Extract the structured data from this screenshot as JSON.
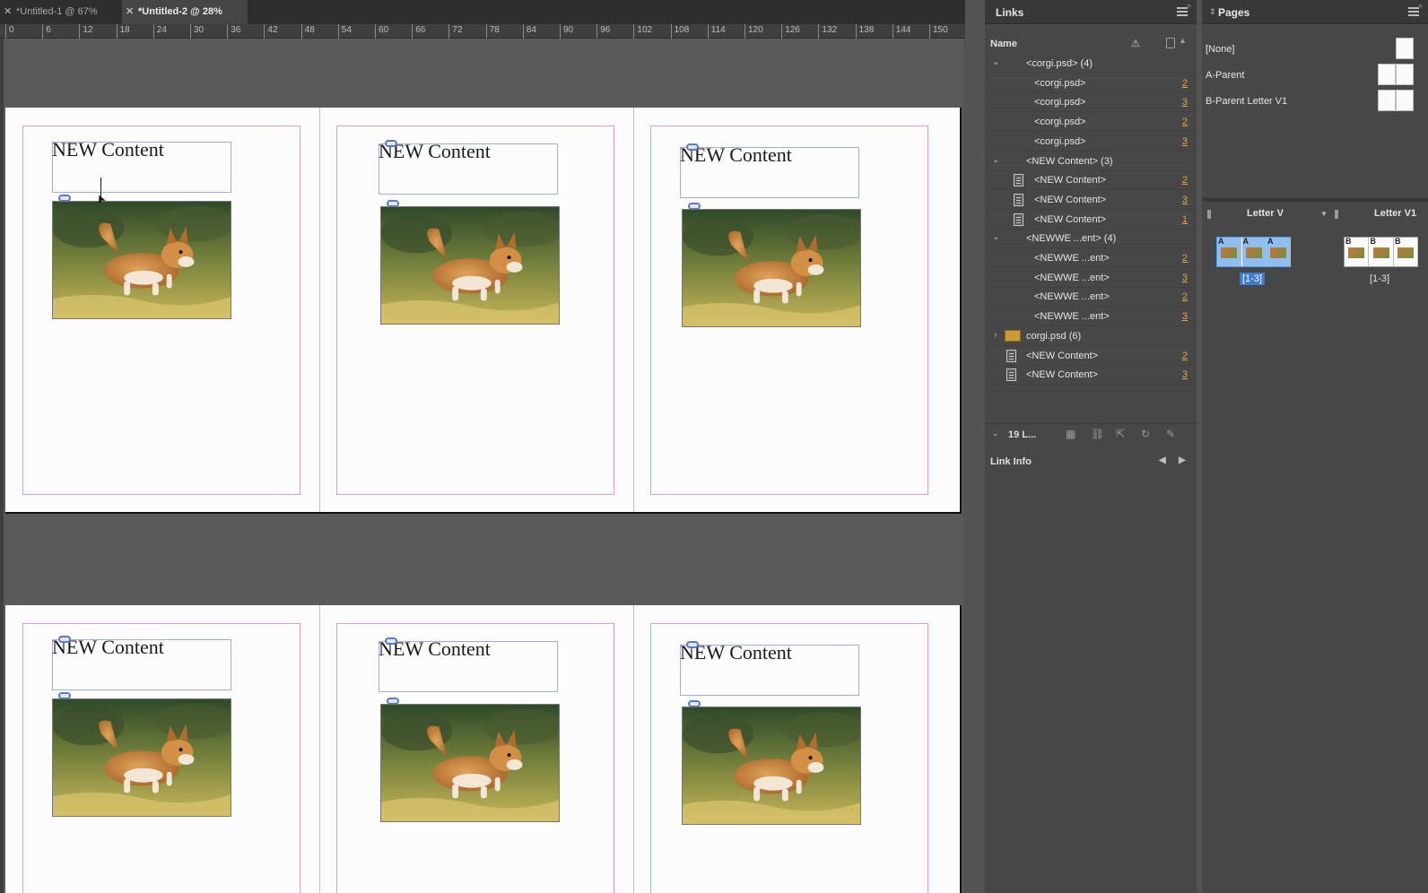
{
  "tabs": [
    {
      "label": "*Untitled-1 @ 67%",
      "active": false
    },
    {
      "label": "*Untitled-2 @ 28%",
      "active": true
    }
  ],
  "ruler": {
    "ticks": [
      "0",
      "6",
      "12",
      "18",
      "24",
      "30",
      "36",
      "42",
      "48",
      "54",
      "60",
      "66",
      "72",
      "78",
      "84",
      "90",
      "96",
      "102",
      "108",
      "114",
      "120",
      "126",
      "132",
      "138",
      "144",
      "150"
    ]
  },
  "canvas": {
    "frame_text": "NEW Content",
    "spreads": 2,
    "pages_per_spread": 3
  },
  "links_panel": {
    "title": "Links",
    "column_name": "Name",
    "rows": [
      {
        "label": "<corgi.psd> (4)",
        "page": "",
        "level": 1,
        "expanded": true,
        "icon": "none"
      },
      {
        "label": "<corgi.psd>",
        "page": "2",
        "level": 2,
        "icon": "none"
      },
      {
        "label": "<corgi.psd>",
        "page": "3",
        "level": 2,
        "icon": "none"
      },
      {
        "label": "<corgi.psd>",
        "page": "2",
        "level": 2,
        "icon": "none"
      },
      {
        "label": "<corgi.psd>",
        "page": "3",
        "level": 2,
        "icon": "none"
      },
      {
        "label": "<NEW Content> (3)",
        "page": "",
        "level": 1,
        "expanded": true,
        "icon": "none"
      },
      {
        "label": "<NEW Content>",
        "page": "2",
        "level": 2,
        "icon": "doc"
      },
      {
        "label": "<NEW Content>",
        "page": "3",
        "level": 2,
        "icon": "doc"
      },
      {
        "label": "<NEW Content>",
        "page": "1",
        "level": 2,
        "icon": "doc"
      },
      {
        "label": "<NEWWE ...ent> (4)",
        "page": "",
        "level": 1,
        "expanded": true,
        "icon": "none"
      },
      {
        "label": "<NEWWE ...ent>",
        "page": "2",
        "level": 2,
        "icon": "none"
      },
      {
        "label": "<NEWWE ...ent>",
        "page": "3",
        "level": 2,
        "icon": "none"
      },
      {
        "label": "<NEWWE ...ent>",
        "page": "2",
        "level": 2,
        "icon": "none"
      },
      {
        "label": "<NEWWE ...ent>",
        "page": "3",
        "level": 2,
        "icon": "none"
      },
      {
        "label": "corgi.psd (6)",
        "page": "",
        "level": 1,
        "expanded": false,
        "icon": "psd"
      },
      {
        "label": "<NEW Content>",
        "page": "2",
        "level": 1,
        "icon": "doc"
      },
      {
        "label": "<NEW Content>",
        "page": "3",
        "level": 1,
        "icon": "doc"
      }
    ],
    "footer_count": "19 L...",
    "link_info": "Link Info"
  },
  "pages_panel": {
    "title": "Pages",
    "parents": [
      {
        "label": "[None]",
        "pages": 1
      },
      {
        "label": "A-Parent",
        "pages": 2
      },
      {
        "label": "B-Parent Letter V1",
        "pages": 2
      }
    ],
    "alternate_layouts": [
      {
        "name": "Letter V",
        "range": "[1-3]",
        "letters": [
          "A",
          "A",
          "A"
        ],
        "selected": true
      },
      {
        "name": "Letter V1",
        "range": "[1-3]",
        "letters": [
          "B",
          "B",
          "B"
        ],
        "selected": false
      }
    ]
  },
  "colors": {
    "accent": "#5d9ee0",
    "page_number": "#e8a33d",
    "margin": "#d89ed8"
  }
}
